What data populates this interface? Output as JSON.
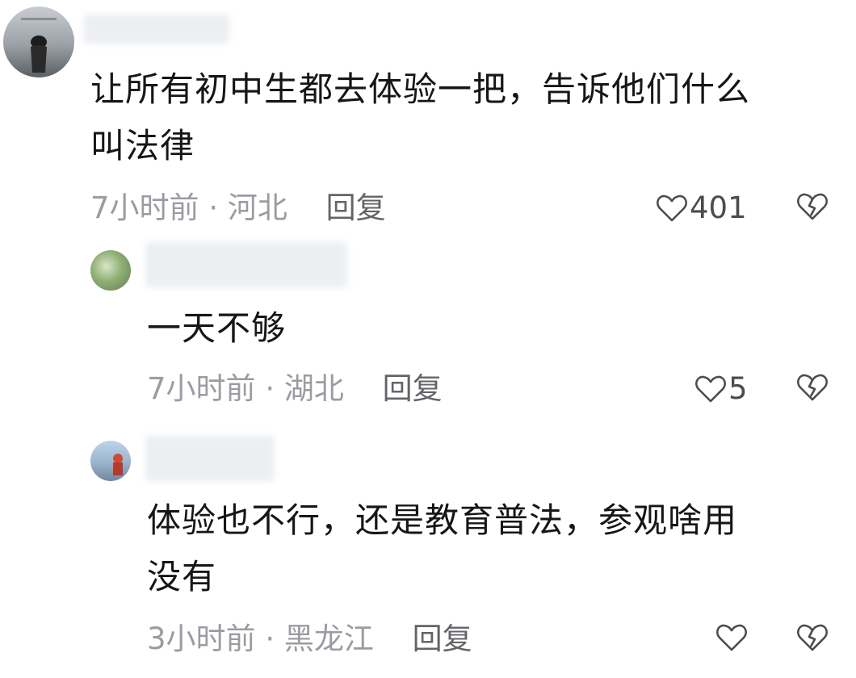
{
  "colors": {
    "text": "#161616",
    "meta": "#9a9ca1",
    "reply": "#626468",
    "icon": "#4a4c50"
  },
  "comments": [
    {
      "lines": [
        "让所有初中生都去体验一把，告诉他们什么",
        "叫法律"
      ],
      "time": "7小时前",
      "location": "河北",
      "reply_label": "回复",
      "likes": "401"
    },
    {
      "lines": [
        "一天不够"
      ],
      "time": "7小时前",
      "location": "湖北",
      "reply_label": "回复",
      "likes": "5"
    },
    {
      "lines": [
        "体验也不行，还是教育普法，参观啥用",
        "没有"
      ],
      "time": "3小时前",
      "location": "黑龙江",
      "reply_label": "回复",
      "likes": ""
    }
  ],
  "icons": {
    "like": "heart-outline-icon",
    "dislike": "broken-heart-icon"
  }
}
